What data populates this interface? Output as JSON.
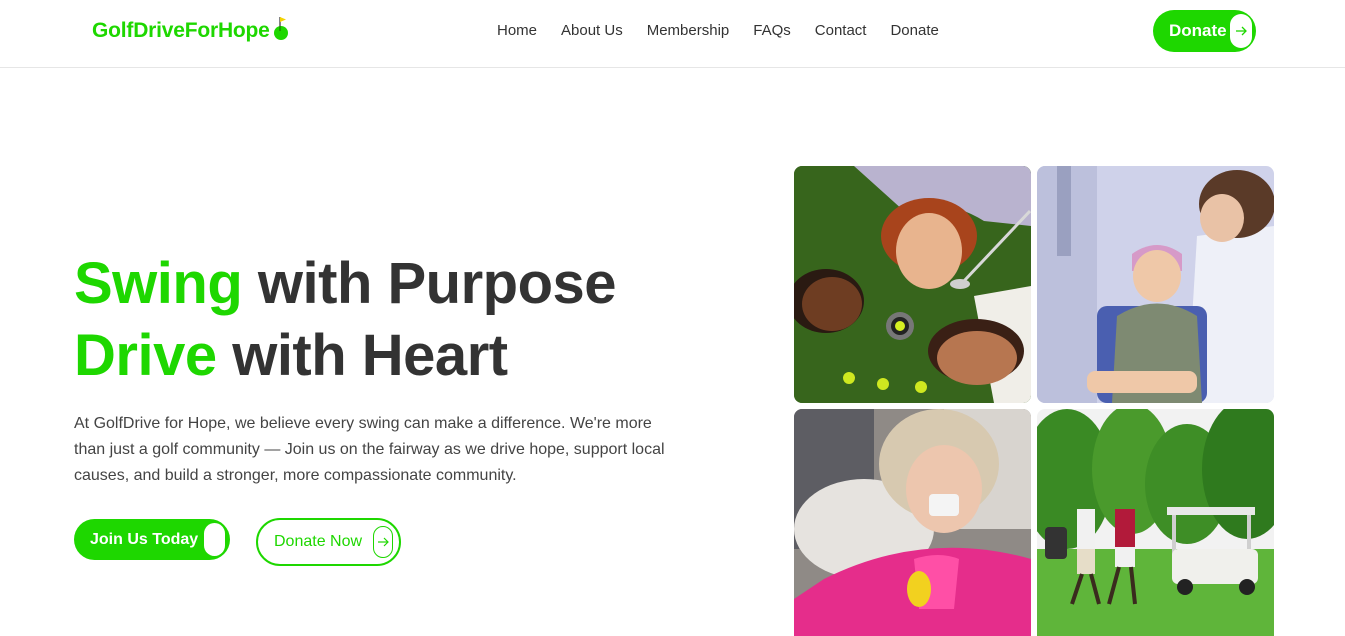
{
  "header": {
    "logo_text": "GolfDriveForHope",
    "nav": [
      {
        "label": "Home"
      },
      {
        "label": "About Us"
      },
      {
        "label": "Membership"
      },
      {
        "label": "FAQs"
      },
      {
        "label": "Contact"
      },
      {
        "label": "Donate"
      }
    ],
    "donate_button": "Donate"
  },
  "hero": {
    "title_line1_accent": "Swing",
    "title_line1_rest": " with Purpose",
    "title_line2_accent": "Drive",
    "title_line2_rest": " with Heart",
    "description": "At GolfDrive for Hope, we believe every swing can make a difference. We're more than just a golf community — Join us on the fairway as we drive hope, support local causes, and build a stronger, more compassionate community.",
    "primary_button": "Join Us Today",
    "secondary_button": "Donate Now"
  },
  "colors": {
    "accent": "#1ed700",
    "text": "#333333"
  },
  "icons": {
    "logo": "golf-flag-ball-icon",
    "button_arrow": "arrow-right-icon"
  }
}
